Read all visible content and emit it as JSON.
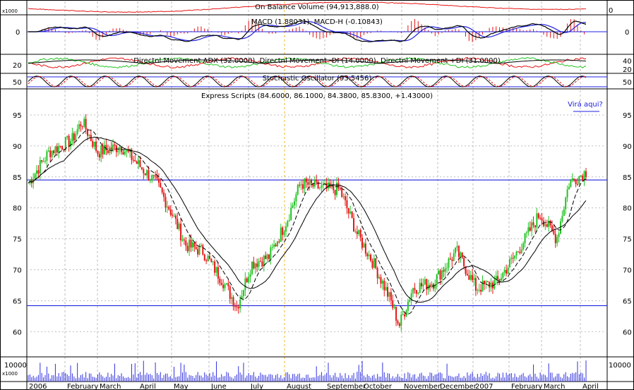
{
  "panels": {
    "obv": {
      "title": "On Balance Volume (94,913,888.0)",
      "scale_tag": "x1000",
      "right_tick": "0"
    },
    "macd": {
      "title": "MACD (1.88031), MACD-H (-0.10843)",
      "left_tick": "0",
      "right_tick": "0"
    },
    "dmi": {
      "title": "Directnl Movement ADX (32.0000), Directnl Movement -DI (14.0000), Directnl Movement +DI (31.0000)",
      "left_tick": "20",
      "right_ticks": [
        "40",
        "20"
      ]
    },
    "stoch": {
      "title": "Stochastic Oscillator (93.5456)",
      "left_tick": "50",
      "right_tick": "50"
    },
    "price": {
      "title": "Express Scripts (84.6000, 86.1000, 84.3800, 85.8300, +1.43000)",
      "annotation": "Virá aqui?"
    },
    "volume": {
      "scale_tag": "x1000",
      "left_tick": "10000",
      "right_tick": "10000"
    }
  },
  "colors": {
    "up": "#22c322",
    "down": "#e61414",
    "support": "#2020e0",
    "grid": "#bdbdbd",
    "obv_line": "#e61414",
    "macd_line": "#000000",
    "macd_signal": "#2020e0",
    "dmi_adx": "#000000",
    "dmi_minus": "#e61414",
    "dmi_plus": "#22c322",
    "volume_bar": "#3030e0"
  },
  "chart_data": {
    "type": "line",
    "title": "Express Scripts (84.6000, 86.1000, 84.3800, 85.8300, +1.43000)",
    "x_axis_labels": [
      "2006",
      "February",
      "March",
      "April",
      "May",
      "June",
      "July",
      "August",
      "September",
      "October",
      "November",
      "December",
      "2007",
      "February",
      "March",
      "April"
    ],
    "y_ticks": [
      60,
      65,
      70,
      75,
      80,
      85,
      90,
      95
    ],
    "ylim": [
      58,
      98
    ],
    "series": [
      {
        "name": "Express Scripts",
        "x": [
          "2006-01-03",
          "2006-01-20",
          "2006-02-08",
          "2006-02-16",
          "2006-03-01",
          "2006-03-20",
          "2006-04-03",
          "2006-04-18",
          "2006-05-01",
          "2006-05-12",
          "2006-05-26",
          "2006-06-12",
          "2006-06-23",
          "2006-07-05",
          "2006-07-19",
          "2006-08-03",
          "2006-08-14",
          "2006-09-05",
          "2006-09-15",
          "2006-09-29",
          "2006-10-13",
          "2006-10-27",
          "2006-11-03",
          "2006-11-14",
          "2006-12-01",
          "2006-12-20",
          "2007-01-05",
          "2007-01-22",
          "2007-02-05",
          "2007-02-26",
          "2007-03-12",
          "2007-03-22",
          "2007-04-05"
        ],
        "values": [
          84,
          89,
          91,
          94,
          89,
          90,
          87,
          84,
          79,
          74,
          73,
          68,
          64,
          71,
          72,
          78,
          84,
          83,
          83,
          76,
          71,
          65,
          61,
          67,
          68,
          73,
          67,
          68,
          72,
          79,
          75,
          84,
          85.83
        ]
      }
    ],
    "support_lines": [
      84.5,
      64.2
    ]
  }
}
